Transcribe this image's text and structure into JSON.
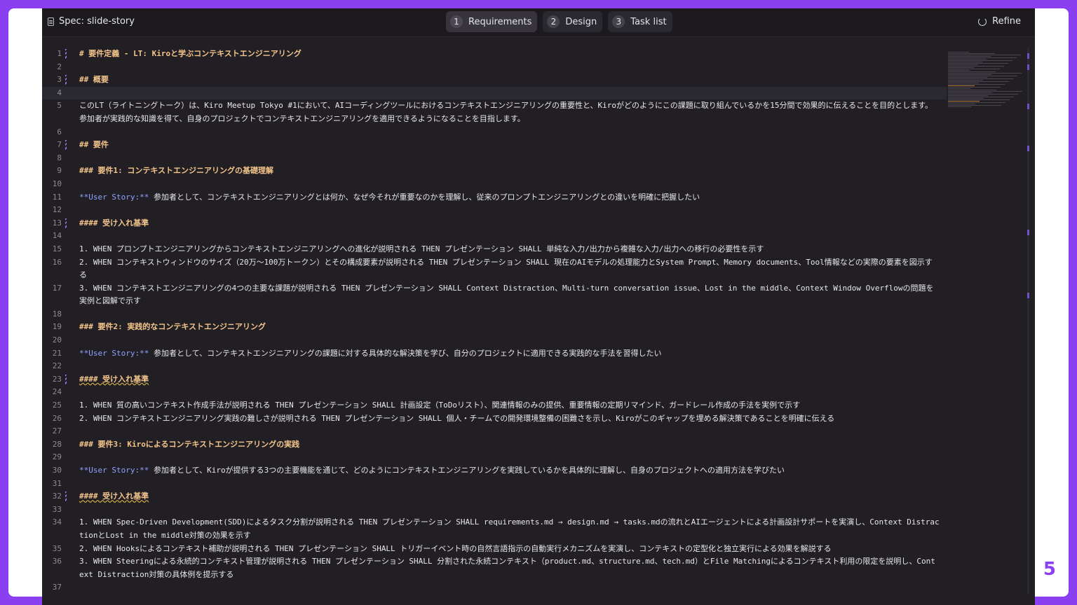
{
  "spec_title": "Spec: slide-story",
  "tabs": [
    {
      "num": "1",
      "label": "Requirements"
    },
    {
      "num": "2",
      "label": "Design"
    },
    {
      "num": "3",
      "label": "Task list"
    }
  ],
  "refine_label": "Refine",
  "page_number": "5",
  "lines": [
    {
      "n": "1",
      "text": "# 要件定義 - LT: Kiroと学ぶコンテキストエンジニアリング"
    },
    {
      "n": "2",
      "text": ""
    },
    {
      "n": "3",
      "text": "## 概要"
    },
    {
      "n": "4",
      "text": ""
    },
    {
      "n": "5",
      "text": "このLT（ライトニングトーク）は、Kiro Meetup Tokyo #1において、AIコーディングツールにおけるコンテキストエンジニアリングの重要性と、Kiroがどのようにこの課題に取り組んでいるかを15分間で効果的に伝えることを目的とします。参加者が実践的な知識を得て、自身のプロジェクトでコンテキストエンジニアリングを適用できるようになることを目指します。"
    },
    {
      "n": "6",
      "text": ""
    },
    {
      "n": "7",
      "text": "## 要件"
    },
    {
      "n": "8",
      "text": ""
    },
    {
      "n": "9",
      "text": "### 要件1: コンテキストエンジニアリングの基礎理解"
    },
    {
      "n": "10",
      "text": ""
    },
    {
      "n": "11",
      "us": "**User Story:**",
      "text": " 参加者として、コンテキストエンジニアリングとは何か、なぜ今それが重要なのかを理解し、従来のプロンプトエンジニアリングとの違いを明確に把握したい"
    },
    {
      "n": "12",
      "text": ""
    },
    {
      "n": "13",
      "text": "#### 受け入れ基準"
    },
    {
      "n": "14",
      "text": ""
    },
    {
      "n": "15",
      "text": "1. WHEN プロンプトエンジニアリングからコンテキストエンジニアリングへの進化が説明される THEN プレゼンテーション SHALL 単純な入力/出力から複雑な入力/出力への移行の必要性を示す"
    },
    {
      "n": "16",
      "text": "2. WHEN コンテキストウィンドウのサイズ（20万〜100万トークン）とその構成要素が説明される THEN プレゼンテーション SHALL 現在のAIモデルの処理能力とSystem Prompt、Memory documents、Tool情報などの実際の要素を図示する"
    },
    {
      "n": "17",
      "text": "3. WHEN コンテキストエンジニアリングの4つの主要な課題が説明される THEN プレゼンテーション SHALL Context Distraction、Multi-turn conversation issue、Lost in the middle、Context Window Overflowの問題を実例と図解で示す"
    },
    {
      "n": "18",
      "text": ""
    },
    {
      "n": "19",
      "text": "### 要件2: 実践的なコンテキストエンジニアリング"
    },
    {
      "n": "20",
      "text": ""
    },
    {
      "n": "21",
      "us": "**User Story:**",
      "text": " 参加者として、コンテキストエンジニアリングの課題に対する具体的な解決策を学び、自分のプロジェクトに適用できる実践的な手法を習得したい"
    },
    {
      "n": "22",
      "text": ""
    },
    {
      "n": "23",
      "text": "#### 受け入れ基準"
    },
    {
      "n": "24",
      "text": ""
    },
    {
      "n": "25",
      "text": "1. WHEN 質の高いコンテキスト作成手法が説明される THEN プレゼンテーション SHALL 計画設定（ToDoリスト）、関連情報のみの提供、重要情報の定期リマインド、ガードレール作成の手法を実例で示す"
    },
    {
      "n": "26",
      "text": "2. WHEN コンテキストエンジニアリング実践の難しさが説明される THEN プレゼンテーション SHALL 個人・チームでの開発環境整備の困難さを示し、Kiroがこのギャップを埋める解決策であることを明確に伝える"
    },
    {
      "n": "27",
      "text": ""
    },
    {
      "n": "28",
      "text": "### 要件3: Kiroによるコンテキストエンジニアリングの実践"
    },
    {
      "n": "29",
      "text": ""
    },
    {
      "n": "30",
      "us": "**User Story:**",
      "text": " 参加者として、Kiroが提供する3つの主要機能を通じて、どのようにコンテキストエンジニアリングを実践しているかを具体的に理解し、自身のプロジェクトへの適用方法を学びたい"
    },
    {
      "n": "31",
      "text": ""
    },
    {
      "n": "32",
      "text": "#### 受け入れ基準"
    },
    {
      "n": "33",
      "text": ""
    },
    {
      "n": "34",
      "text": "1. WHEN Spec-Driven Development(SDD)によるタスク分割が説明される THEN プレゼンテーション SHALL requirements.md → design.md → tasks.mdの流れとAIエージェントによる計画設計サポートを実演し、Context DistractionとLost in the middle対策の効果を示す"
    },
    {
      "n": "35",
      "text": "2. WHEN Hooksによるコンテキスト補助が説明される THEN プレゼンテーション SHALL トリガーイベント時の自然言語指示の自動実行メカニズムを実演し、コンテキストの定型化と独立実行による効果を解説する"
    },
    {
      "n": "36",
      "text": "3. WHEN Steeringによる永続的コンテキスト管理が説明される THEN プレゼンテーション SHALL 分割された永続コンテキスト（product.md、structure.md、tech.md）とFile Matchingによるコンテキスト利用の限定を説明し、Context Distraction対策の具体例を提示する"
    },
    {
      "n": "37",
      "text": ""
    }
  ]
}
